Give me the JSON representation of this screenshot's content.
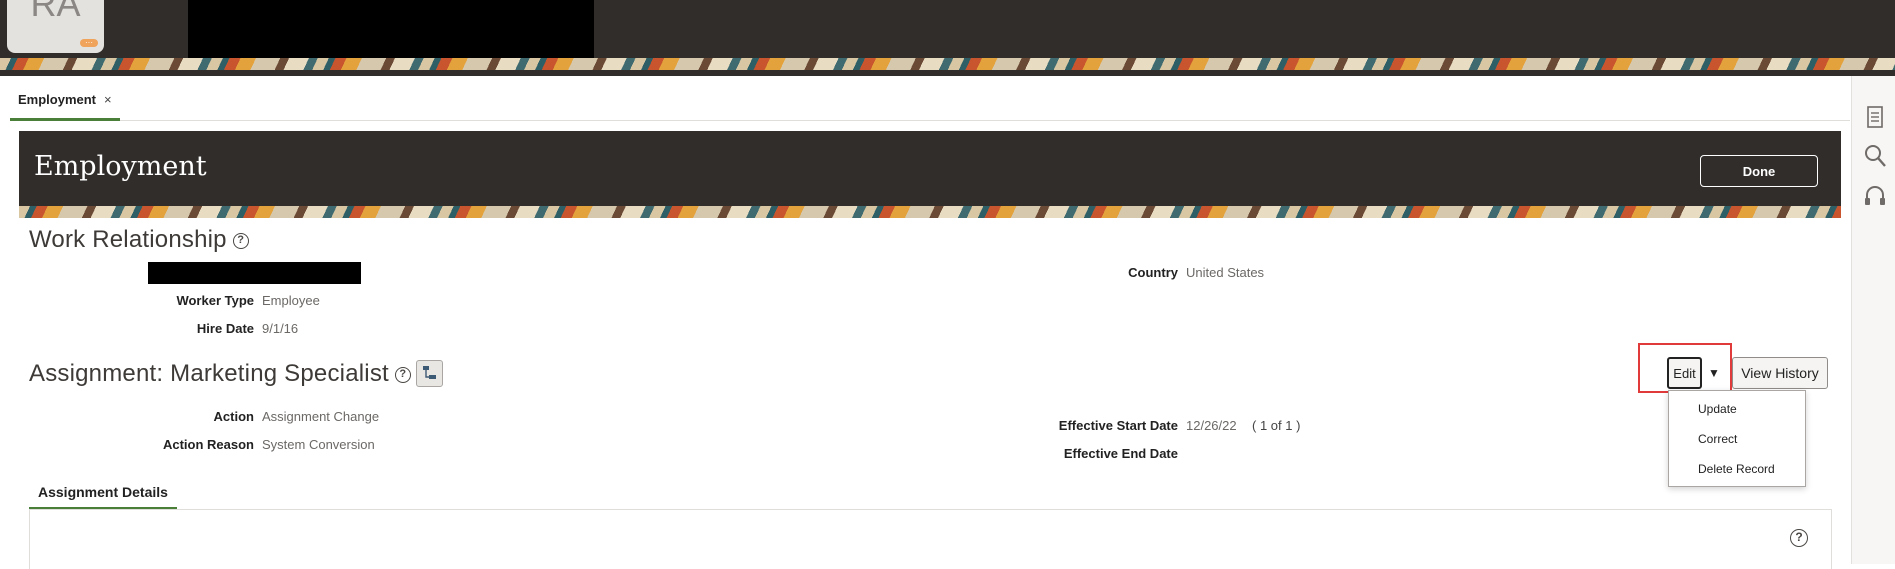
{
  "top_bar": {
    "avatar_initials": "RA",
    "avatar_badge": "···"
  },
  "tabs": {
    "active_tab": "Employment",
    "close_glyph": "×"
  },
  "header": {
    "title": "Employment",
    "done_label": "Done"
  },
  "work_relationship": {
    "title": "Work Relationship",
    "help_glyph": "?",
    "fields": [
      {
        "label": "Worker Type",
        "value": "Employee"
      },
      {
        "label": "Hire Date",
        "value": "9/1/16"
      },
      {
        "label": "Country",
        "value": "United States"
      }
    ]
  },
  "assignment": {
    "title": "Assignment: Marketing Specialist",
    "help_glyph": "?",
    "fields": [
      {
        "label": "Action",
        "value": "Assignment Change"
      },
      {
        "label": "Action Reason",
        "value": "System Conversion"
      },
      {
        "label": "Effective Start Date",
        "value": "12/26/22"
      },
      {
        "label": "Effective End Date",
        "value": ""
      }
    ],
    "record_position": "( 1 of 1 )",
    "edit_label": "Edit",
    "dropdown_glyph": "▼",
    "history_label": "View History",
    "edit_menu": [
      "Update",
      "Correct",
      "Delete Record"
    ]
  },
  "details": {
    "subtab_label": "Assignment Details",
    "help_glyph": "?"
  },
  "side_panel": {
    "icons": [
      "list-icon",
      "search-icon",
      "headset-icon"
    ]
  },
  "colors": {
    "brand_dark": "#312d2a",
    "tab_accent": "#4a7f3a",
    "highlight": "#e03a3a"
  }
}
